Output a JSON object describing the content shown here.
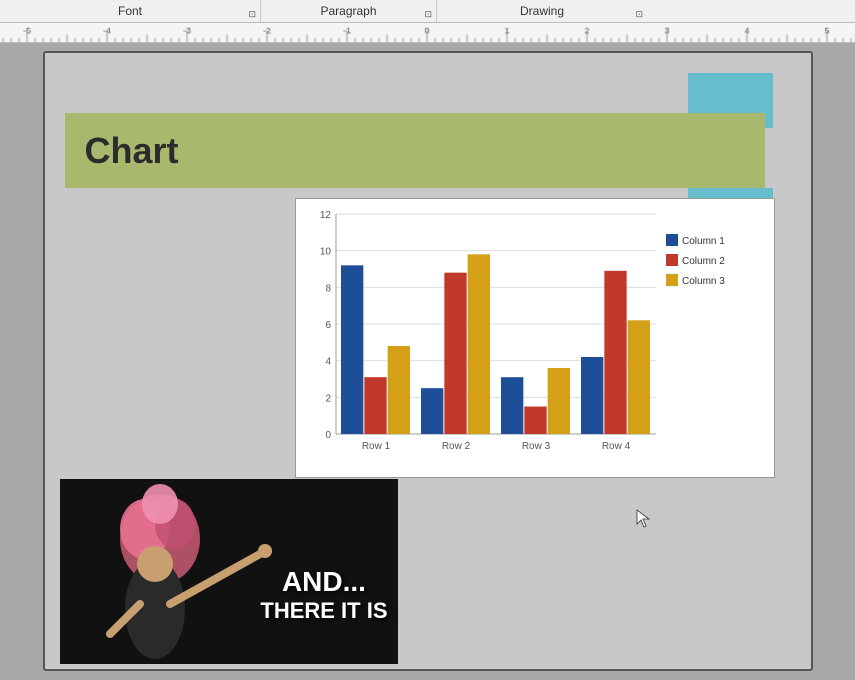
{
  "toolbar": {
    "font_label": "Font",
    "paragraph_label": "Paragraph",
    "drawing_label": "Drawing"
  },
  "ruler": {
    "marks": [
      "-5",
      "-4",
      "-3",
      "-2",
      "-1",
      "0",
      "1",
      "2",
      "3",
      "4",
      "5"
    ]
  },
  "slide": {
    "chart_title": "Chart",
    "image_text_line1": "AND...",
    "image_text_line2": "THERE IT IS"
  },
  "chart": {
    "y_max": 12,
    "y_labels": [
      "0",
      "2",
      "4",
      "6",
      "8",
      "10",
      "12"
    ],
    "x_labels": [
      "Row 1",
      "Row 2",
      "Row 3",
      "Row 4"
    ],
    "legend": [
      "Column 1",
      "Column 2",
      "Column 3"
    ],
    "legend_colors": [
      "#1f4e99",
      "#c0392b",
      "#d4a017"
    ],
    "data": [
      [
        9.2,
        3.1,
        4.8
      ],
      [
        2.5,
        8.8,
        9.8
      ],
      [
        3.1,
        1.5,
        3.6
      ],
      [
        4.2,
        8.9,
        6.2
      ]
    ]
  }
}
